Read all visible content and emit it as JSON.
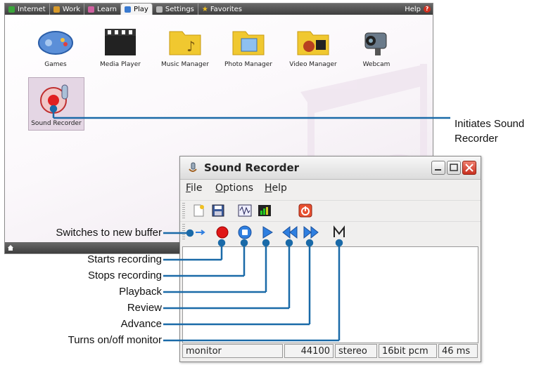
{
  "desktop": {
    "tabs": [
      {
        "label": "Internet",
        "color": "#3aa63a"
      },
      {
        "label": "Work",
        "color": "#d89a2a"
      },
      {
        "label": "Learn",
        "color": "#d060a0"
      },
      {
        "label": "Play",
        "color": "#3a7ad0",
        "active": true
      },
      {
        "label": "Settings",
        "color": "#bbbbbb"
      },
      {
        "label": "Favorites",
        "color": "#f0c020"
      }
    ],
    "help_label": "Help",
    "help_badge": "?",
    "apps": [
      {
        "label": "Games",
        "icon": "gamepad-icon"
      },
      {
        "label": "Media Player",
        "icon": "clapperboard-icon"
      },
      {
        "label": "Music Manager",
        "icon": "music-folder-icon"
      },
      {
        "label": "Photo Manager",
        "icon": "photo-folder-icon"
      },
      {
        "label": "Video Manager",
        "icon": "video-folder-icon"
      },
      {
        "label": "Webcam",
        "icon": "webcam-icon"
      },
      {
        "label": "Sound Recorder",
        "icon": "sound-recorder-icon",
        "selected": true
      }
    ]
  },
  "window": {
    "title": "Sound Recorder",
    "menus": [
      "File",
      "Options",
      "Help"
    ],
    "menu_mnemonics": [
      "F",
      "O",
      "H"
    ],
    "toolbar1_icons": [
      "new-file-icon",
      "save-icon",
      "waveform-icon",
      "level-meter-icon",
      "power-icon"
    ],
    "toolbar2_icons": [
      "new-buffer-arrow-icon",
      "record-icon",
      "stop-icon",
      "play-icon",
      "rewind-icon",
      "fast-forward-icon",
      "monitor-icon"
    ],
    "status": {
      "mode": "monitor",
      "rate": "44100",
      "channels": "stereo",
      "format": "16bit pcm",
      "latency": "46 ms"
    }
  },
  "callouts": {
    "initiates": "Initiates Sound\nRecorder",
    "new_buffer": "Switches to new buffer",
    "start": "Starts recording",
    "stop": "Stops recording",
    "playback": "Playback",
    "review": "Review",
    "advance": "Advance",
    "monitor": "Turns on/off monitor"
  },
  "colors": {
    "callout_line": "#1a6aa8",
    "record": "#e01818",
    "transport_blue": "#2f7fe0"
  }
}
